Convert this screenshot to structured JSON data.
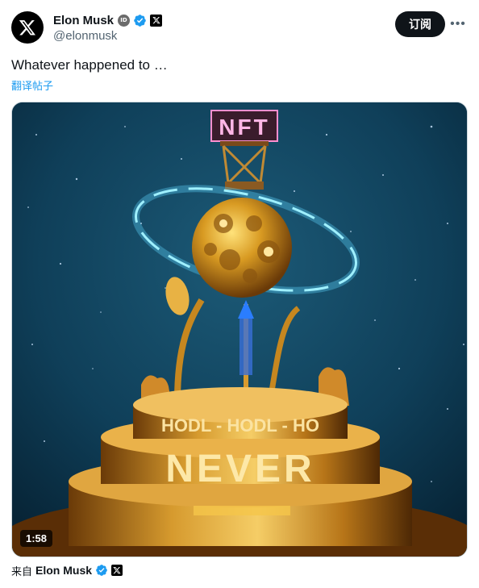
{
  "author": {
    "name": "Elon Musk",
    "handle": "@elonmusk",
    "avatar_icon": "x-logo-icon",
    "id_badge": "ID"
  },
  "actions": {
    "subscribe_label": "订阅",
    "more_label": "•••"
  },
  "tweet": {
    "text": "Whatever happened to …",
    "translate_label": "翻译帖子"
  },
  "media": {
    "duration": "1:58",
    "sign_text": "NFT",
    "ring_text": "HODL - HODL - HO",
    "base_text": "NEVER"
  },
  "footer": {
    "from_prefix": "来自",
    "from_name": "Elon Musk"
  },
  "colors": {
    "accent": "#1d9bf0",
    "button_bg": "#0f1419",
    "text_primary": "#0f1419",
    "text_secondary": "#536471"
  }
}
